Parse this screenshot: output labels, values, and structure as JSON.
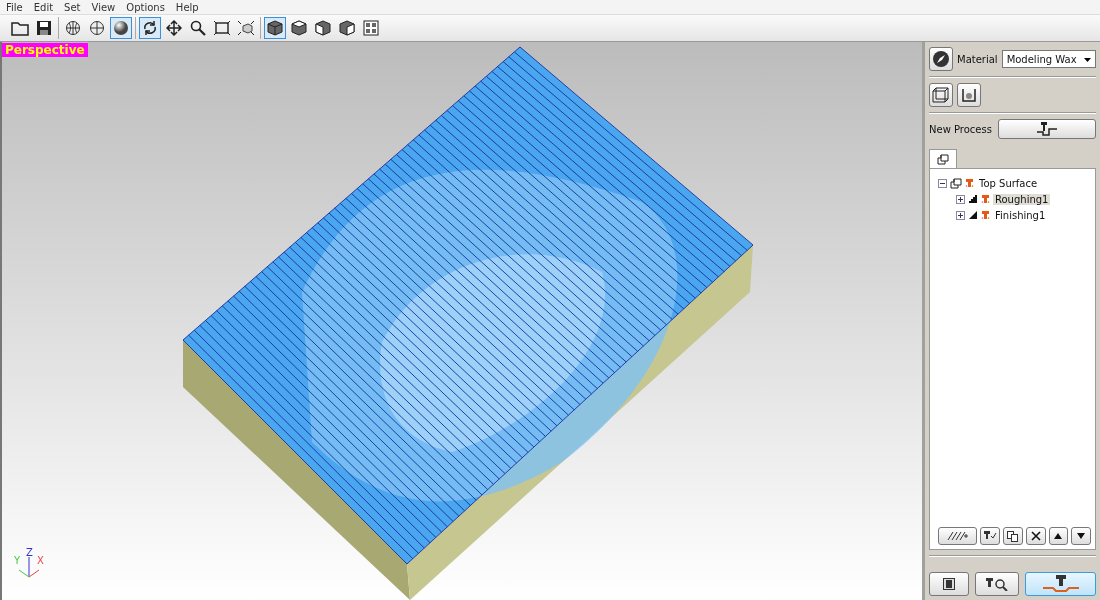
{
  "menu": [
    "File",
    "Edit",
    "Set",
    "View",
    "Options",
    "Help"
  ],
  "toolbar": [
    [
      {
        "kind": "open",
        "selected": false
      },
      {
        "kind": "save",
        "selected": false
      }
    ],
    [
      {
        "kind": "wireframe",
        "selected": false
      },
      {
        "kind": "hidden-line",
        "selected": false
      },
      {
        "kind": "shaded",
        "selected": true
      }
    ],
    [
      {
        "kind": "rotate",
        "selected": true
      },
      {
        "kind": "pan",
        "selected": false
      },
      {
        "kind": "zoom",
        "selected": false
      },
      {
        "kind": "fit",
        "selected": false
      },
      {
        "kind": "zoom-box",
        "selected": false
      }
    ],
    [
      {
        "kind": "cube-dark",
        "selected": true
      },
      {
        "kind": "cube-top",
        "selected": false
      },
      {
        "kind": "cube-front",
        "selected": false
      },
      {
        "kind": "cube-side",
        "selected": false
      },
      {
        "kind": "multi-view",
        "selected": false
      }
    ]
  ],
  "viewport": {
    "view_label": "Perspective",
    "axes": {
      "x": "X",
      "y": "Y",
      "z": "Z"
    }
  },
  "panel": {
    "material_label": "Material",
    "material_value": "Modeling Wax",
    "new_process_label": "New Process",
    "tree": [
      {
        "label": "Top Surface",
        "kind": "surface",
        "expanded": true,
        "selected": false,
        "children": [
          {
            "label": "Roughing1",
            "kind": "roughing",
            "expanded": false,
            "selected": true
          },
          {
            "label": "Finishing1",
            "kind": "finishing",
            "expanded": false,
            "selected": false
          }
        ]
      }
    ]
  }
}
